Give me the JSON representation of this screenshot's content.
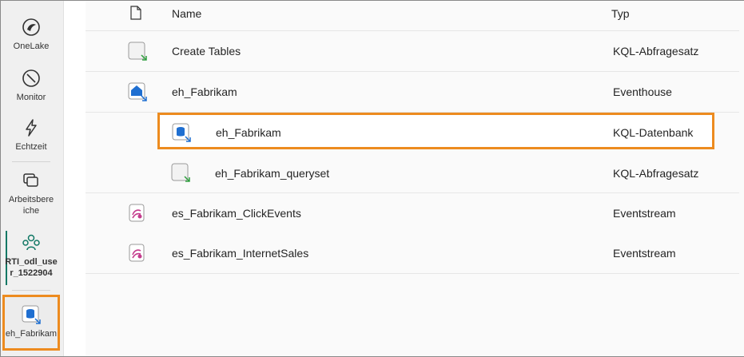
{
  "rail": {
    "items": [
      {
        "label": "OneLake",
        "icon": "onelake-icon"
      },
      {
        "label": "Monitor",
        "icon": "monitor-icon"
      },
      {
        "label": "Echtzeit",
        "icon": "lightning-icon"
      },
      {
        "label": "Arbeitsbereiche",
        "label_line1": "Arbeitsbere",
        "label_line2": "iche",
        "icon": "workspaces-icon"
      },
      {
        "label": "RTI_odl_user_1522904",
        "label_line1": "RTI_odl_use",
        "label_line2": "r_1522904",
        "icon": "workspace-people-icon"
      },
      {
        "label": "eh_Fabrikam",
        "icon": "kql-database-icon"
      }
    ]
  },
  "table": {
    "headers": {
      "name": "Name",
      "type": "Typ"
    },
    "rows": [
      {
        "name": "Create Tables",
        "type": "KQL-Abfragesatz",
        "icon": "kql-queryset-icon"
      },
      {
        "name": "eh_Fabrikam",
        "type": "Eventhouse",
        "icon": "eventhouse-icon"
      },
      {
        "name": "eh_Fabrikam",
        "type": "KQL-Datenbank",
        "icon": "kql-database-icon"
      },
      {
        "name": "eh_Fabrikam_queryset",
        "type": "KQL-Abfragesatz",
        "icon": "kql-queryset-icon"
      },
      {
        "name": "es_Fabrikam_ClickEvents",
        "type": "Eventstream",
        "icon": "eventstream-icon"
      },
      {
        "name": "es_Fabrikam_InternetSales",
        "type": "Eventstream",
        "icon": "eventstream-icon"
      }
    ]
  },
  "colors": {
    "highlight": "#ed8b1f",
    "accent": "#117865"
  }
}
